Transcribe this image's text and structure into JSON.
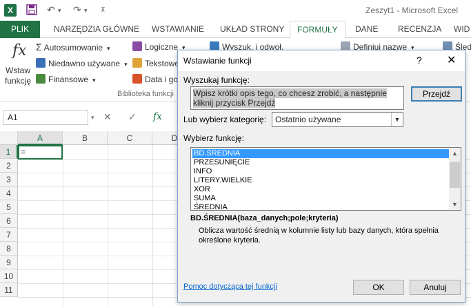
{
  "window": {
    "title": "Zeszyt1 - Microsoft Excel",
    "app_logo": "X"
  },
  "qat": {
    "save_icon": "save-icon",
    "undo_icon": "undo-icon",
    "redo_icon": "redo-icon"
  },
  "tabs": [
    {
      "label": "PLIK"
    },
    {
      "label": "NARZĘDZIA GŁÓWNE"
    },
    {
      "label": "WSTAWIANIE"
    },
    {
      "label": "UKŁAD STRONY"
    },
    {
      "label": "FORMUŁY"
    },
    {
      "label": "DANE"
    },
    {
      "label": "RECENZJA"
    },
    {
      "label": "WID"
    }
  ],
  "ribbon": {
    "insert_function": "Wstaw\nfunkcję",
    "insert_function_l1": "Wstaw",
    "insert_function_l2": "funkcję",
    "autosum": "Autosumowanie",
    "recent": "Niedawno używane",
    "financial": "Finansowe",
    "logical": "Logiczne",
    "text": "Tekstowe",
    "datetime": "Data i go",
    "lookup": "Wyszuk. i odwoł.",
    "define_name": "Definiuj nazwę",
    "trace": "Śled",
    "group_label": "Biblioteka funkcji"
  },
  "formula_bar": {
    "name_box": "A1",
    "cancel": "✕",
    "enter": "✓",
    "fx": "fx"
  },
  "grid": {
    "columns": [
      "A",
      "B",
      "C",
      "D"
    ],
    "rows": [
      "1",
      "2",
      "3",
      "4",
      "5",
      "6",
      "7",
      "8",
      "9",
      "10",
      "11"
    ],
    "a1_value": "="
  },
  "dialog": {
    "title": "Wstawianie funkcji",
    "help": "?",
    "close": "✕",
    "search_label": "Wyszukaj funkcję:",
    "search_value": "Wpisz krótki opis tego, co chcesz zrobić, a następnie kliknij przycisk Przejdź",
    "go_button": "Przejdź",
    "category_label": "Lub wybierz kategorię:",
    "category_value": "Ostatnio używane",
    "functions_label": "Wybierz funkcję:",
    "functions": [
      "BD.ŚREDNIA",
      "PRZESUNIĘCIE",
      "INFO",
      "LITERY.WIELKIE",
      "XOR",
      "SUMA",
      "ŚREDNIA"
    ],
    "selected_index": 0,
    "signature": "BD.ŚREDNIA(baza_danych;pole;kryteria)",
    "description": "Oblicza wartość średnią w kolumnie listy lub bazy danych, która spełnia określone kryteria.",
    "help_link": "Pomoc dotycząca tej funkcji",
    "ok": "OK",
    "cancel": "Anuluj"
  }
}
